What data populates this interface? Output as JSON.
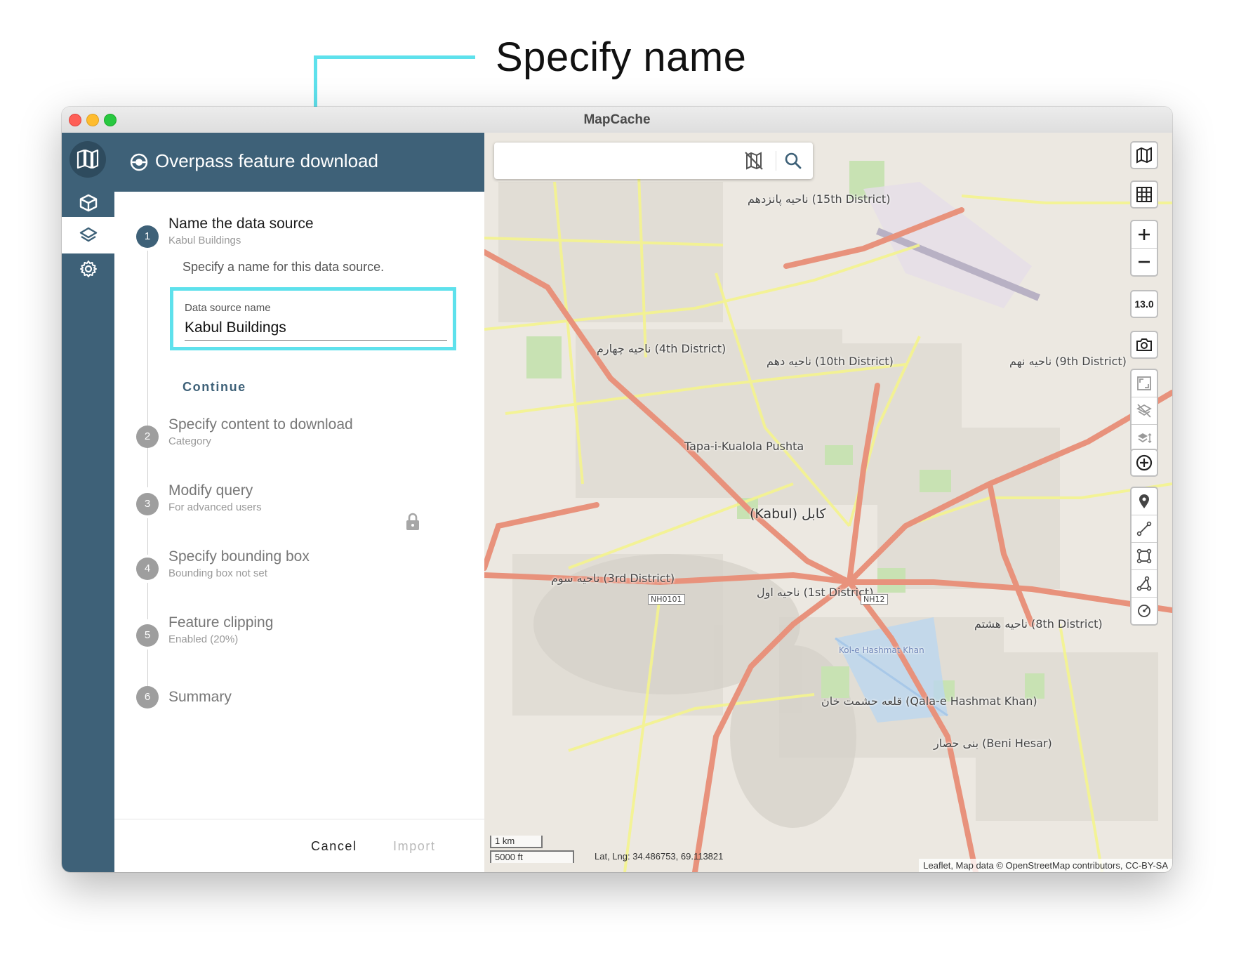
{
  "callout": {
    "title": "Specify name"
  },
  "window": {
    "title": "MapCache"
  },
  "panel": {
    "title": "Overpass feature download",
    "steps": [
      {
        "number": "1",
        "title": "Name the data source",
        "subtitle": "Kabul Buildings",
        "description": "Specify a name for this data source."
      },
      {
        "number": "2",
        "title": "Specify content to download",
        "subtitle": "Category"
      },
      {
        "number": "3",
        "title": "Modify query",
        "subtitle": "For advanced users"
      },
      {
        "number": "4",
        "title": "Specify bounding box",
        "subtitle": "Bounding box not set"
      },
      {
        "number": "5",
        "title": "Feature clipping",
        "subtitle": "Enabled (20%)"
      },
      {
        "number": "6",
        "title": "Summary"
      }
    ],
    "field": {
      "label": "Data source name",
      "value": "Kabul Buildings"
    },
    "continue_label": "Continue",
    "cancel_label": "Cancel",
    "import_label": "Import"
  },
  "map": {
    "zoom_level": "13.0",
    "scale_km": "1 km",
    "scale_ft": "5000 ft",
    "coords": "Lat, Lng: 34.486753, 69.113821",
    "attribution": "Leaflet, Map data © OpenStreetMap contributors, CC-BY-SA",
    "labels": [
      "(Kabul) کابل",
      "ناحیه پانزدهم (15th District)",
      "ناحیه چهارم (4th District)",
      "ناحیه دهم (10th District)",
      "ناحیه نهم (9th District)",
      "ناحیه سوم (3rd District)",
      "ناحیه اول (1st District)",
      "ناحیه هشتم (8th District)",
      "قلعه حشمت خان (Qala-e Hashmat Khan)",
      "بنی حصار (Beni Hesar)",
      "Tapa-i-Kualola Pushta",
      "Kol-e Hashmat Khan",
      "NH0101",
      "NH12"
    ]
  },
  "colors": {
    "sidebar": "#3e6178",
    "accent_highlight": "#5ee1ec",
    "map_background": "#ece8e1",
    "major_road": "#e8927c",
    "secondary_road": "#f7fabf"
  }
}
